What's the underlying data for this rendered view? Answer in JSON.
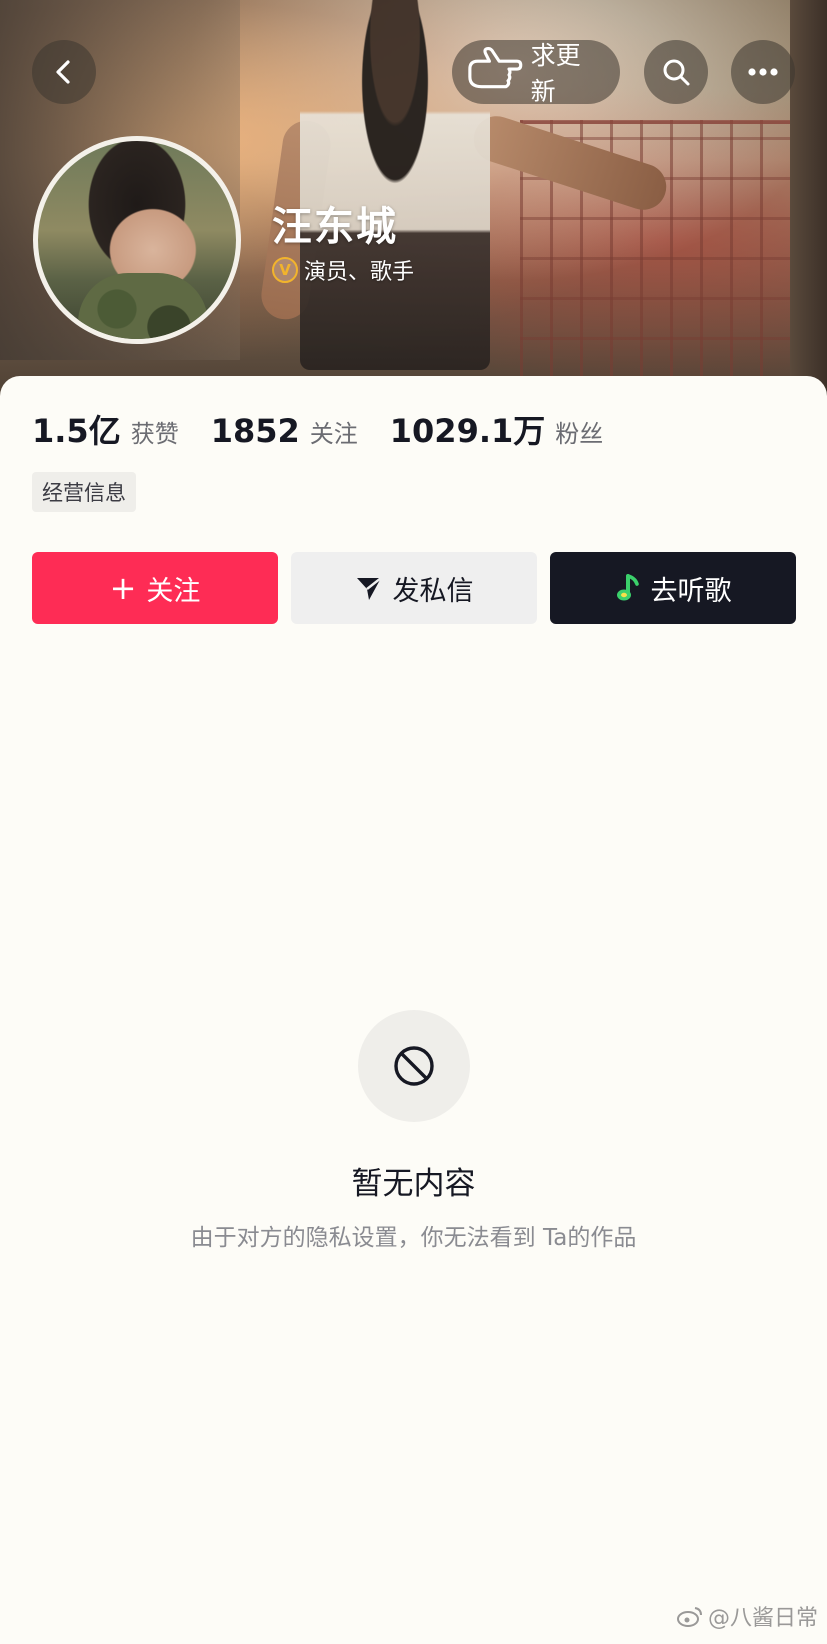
{
  "header": {
    "update_label": "求更新",
    "icons": {
      "back": "back-icon",
      "hand": "hand-point-icon",
      "search": "search-icon",
      "more": "more-icon"
    }
  },
  "profile": {
    "name": "汪东城",
    "verified_mark": "V",
    "verified_text": "演员、歌手",
    "verified_color": "#f2b42c"
  },
  "stats": [
    {
      "value": "1.5亿",
      "label": "获赞"
    },
    {
      "value": "1852",
      "label": "关注"
    },
    {
      "value": "1029.1万",
      "label": "粉丝"
    }
  ],
  "business_tag": "经营信息",
  "actions": {
    "follow_plus": "+",
    "follow_label": "关注",
    "message_label": "发私信",
    "listen_label": "去听歌"
  },
  "colors": {
    "follow": "#fe2c55",
    "dark": "#161823",
    "music_green": "#3bd06b"
  },
  "empty_state": {
    "title": "暂无内容",
    "subtitle": "由于对方的隐私设置，你无法看到 Ta的作品"
  },
  "watermark": "@八酱日常"
}
